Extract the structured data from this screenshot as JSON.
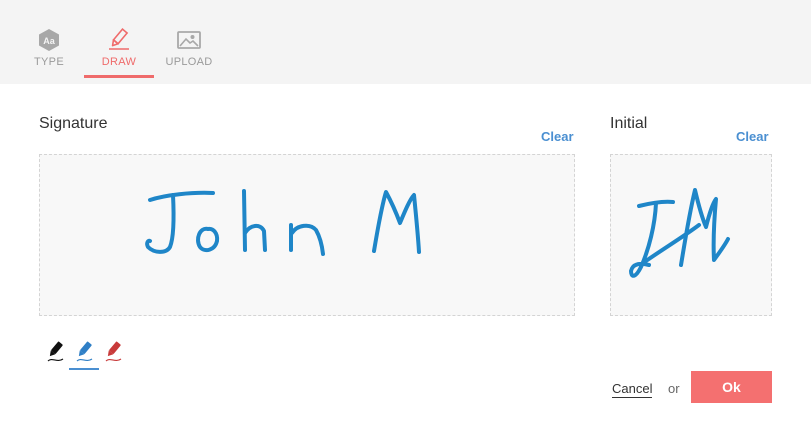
{
  "tabs": [
    {
      "label": "TYPE",
      "icon": "text-type-icon",
      "active": false
    },
    {
      "label": "DRAW",
      "icon": "pencil-draw-icon",
      "active": true
    },
    {
      "label": "UPLOAD",
      "icon": "image-upload-icon",
      "active": false
    }
  ],
  "signature": {
    "title": "Signature",
    "clear_label": "Clear"
  },
  "initial": {
    "title": "Initial",
    "clear_label": "Clear"
  },
  "pens": [
    {
      "icon": "black-pen-icon",
      "color": "#111111",
      "selected": false
    },
    {
      "icon": "blue-pen-icon",
      "color": "#2f7fc6",
      "selected": true
    },
    {
      "icon": "red-pen-icon",
      "color": "#c83a3a",
      "selected": false
    }
  ],
  "actions": {
    "cancel_label": "Cancel",
    "or_label": "or",
    "ok_label": "Ok"
  },
  "colors": {
    "accent": "#ef6b6b",
    "link": "#4a8fd1",
    "ink": "#1f86c8",
    "ok_button": "#f47070"
  }
}
